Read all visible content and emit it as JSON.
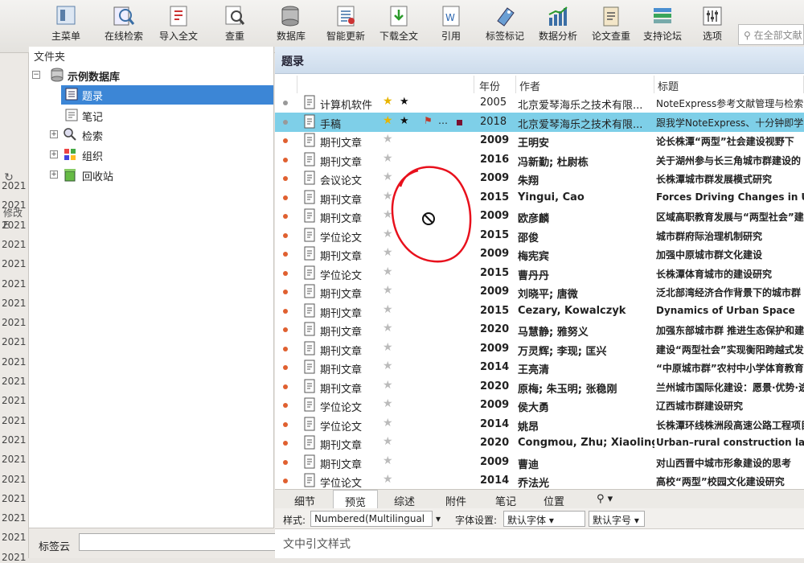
{
  "toolbar": {
    "buttons": [
      {
        "label": "主菜单",
        "icon": "main-menu-icon"
      },
      {
        "label": "在线检索",
        "icon": "online-search-icon"
      },
      {
        "label": "导入全文",
        "icon": "import-fulltext-icon"
      },
      {
        "label": "查重",
        "icon": "duplicate-check-icon"
      },
      {
        "label": "数据库",
        "icon": "database-icon"
      },
      {
        "label": "智能更新",
        "icon": "smart-update-icon"
      },
      {
        "label": "下载全文",
        "icon": "download-fulltext-icon"
      },
      {
        "label": "引用",
        "icon": "cite-icon"
      },
      {
        "label": "标签标记",
        "icon": "tag-icon"
      },
      {
        "label": "数据分析",
        "icon": "data-analysis-icon"
      },
      {
        "label": "论文查重",
        "icon": "paper-check-icon"
      },
      {
        "label": "支持论坛",
        "icon": "forum-icon"
      },
      {
        "label": "选项",
        "icon": "options-icon"
      }
    ],
    "search_placeholder": "在全部文献"
  },
  "left_strip": {
    "modify_label": "修改E",
    "years": [
      "2021",
      "2021",
      "2021",
      "2021",
      "2021",
      "2021",
      "2021",
      "2021",
      "2021",
      "2021",
      "2021",
      "2021",
      "2021",
      "2021",
      "2021",
      "2021",
      "2021",
      "2021",
      "2021",
      "2021"
    ]
  },
  "folder_pane": {
    "header": "文件夹",
    "tree": [
      {
        "label": "示例数据库",
        "icon": "database-icon"
      },
      {
        "label": "题录",
        "icon": "references-icon"
      },
      {
        "label": "笔记",
        "icon": "notes-icon"
      },
      {
        "label": "检索",
        "icon": "search-icon"
      },
      {
        "label": "组织",
        "icon": "organize-icon"
      },
      {
        "label": "回收站",
        "icon": "recycle-bin-icon"
      }
    ],
    "tagcloud_label": "标签云"
  },
  "main": {
    "title": "题录",
    "columns": {
      "year": "年份",
      "author": "作者",
      "title": "标题"
    },
    "rows": [
      {
        "type": "计算机软件",
        "year": "2005",
        "author": "北京爱琴海乐之技术有限...",
        "title": "NoteExpress参考文献管理与检索",
        "starred": true,
        "status": "grey"
      },
      {
        "type": "手稿",
        "year": "2018",
        "author": "北京爱琴海乐之技术有限...",
        "title": "跟我学NoteExpress、十分钟即学",
        "starred": true,
        "status": "grey",
        "selected": true
      },
      {
        "type": "期刊文章",
        "year": "2009",
        "author": "王明安",
        "title": "论长株潭“两型”社会建设视野下",
        "starred": false,
        "status": "red"
      },
      {
        "type": "期刊文章",
        "year": "2016",
        "author": "冯新勤; 杜尉栋",
        "title": "关于湖州参与长三角城市群建设的",
        "starred": false,
        "status": "red"
      },
      {
        "type": "会议论文",
        "year": "2009",
        "author": "朱翔",
        "title": "长株潭城市群发展模式研究",
        "starred": false,
        "status": "red"
      },
      {
        "type": "期刊文章",
        "year": "2015",
        "author": "Yingui, Cao",
        "title": "Forces Driving Changes in Urb",
        "starred": false,
        "status": "red"
      },
      {
        "type": "期刊文章",
        "year": "2009",
        "author": "欧彦麟",
        "title": "区域高职教育发展与“两型社会”建",
        "starred": false,
        "status": "red"
      },
      {
        "type": "学位论文",
        "year": "2015",
        "author": "邵俊",
        "title": "城市群府际治理机制研究",
        "starred": false,
        "status": "red"
      },
      {
        "type": "期刊文章",
        "year": "2009",
        "author": "梅宪宾",
        "title": "加强中原城市群文化建设",
        "starred": false,
        "status": "red"
      },
      {
        "type": "学位论文",
        "year": "2015",
        "author": "曹丹丹",
        "title": "长株潭体育城市的建设研究",
        "starred": false,
        "status": "red"
      },
      {
        "type": "期刊文章",
        "year": "2009",
        "author": "刘晓平; 唐微",
        "title": "泛北部湾经济合作背景下的城市群",
        "starred": false,
        "status": "red"
      },
      {
        "type": "期刊文章",
        "year": "2015",
        "author": "Cezary, Kowalczyk",
        "title": "Dynamics of Urban Space",
        "starred": false,
        "status": "red"
      },
      {
        "type": "期刊文章",
        "year": "2020",
        "author": "马慧静; 雅努义",
        "title": "加强东部城市群 推进生态保护和建设",
        "starred": false,
        "status": "red"
      },
      {
        "type": "期刊文章",
        "year": "2009",
        "author": "万灵辉; 李现; 匡兴",
        "title": "建设“两型社会”实现衡阳跨越式发",
        "starred": false,
        "status": "red"
      },
      {
        "type": "期刊文章",
        "year": "2014",
        "author": "王亮清",
        "title": "“中原城市群”农村中小学体育教育",
        "starred": false,
        "status": "red"
      },
      {
        "type": "期刊文章",
        "year": "2020",
        "author": "原梅; 朱玉明; 张稳刚",
        "title": "兰州城市国际化建设：愿景·优势·途径",
        "starred": false,
        "status": "red"
      },
      {
        "type": "学位论文",
        "year": "2009",
        "author": "侯大勇",
        "title": "辽西城市群建设研究",
        "starred": false,
        "status": "red"
      },
      {
        "type": "学位论文",
        "year": "2014",
        "author": "姚昂",
        "title": "长株潭环线株洲段高速公路工程项目建",
        "starred": false,
        "status": "red"
      },
      {
        "type": "期刊文章",
        "year": "2020",
        "author": "Congmou, Zhu; Xiaoling,",
        "title": "Urban–rural construction land tra",
        "starred": false,
        "status": "red"
      },
      {
        "type": "期刊文章",
        "year": "2009",
        "author": "曹迪",
        "title": "对山西晋中城市形象建设的思考",
        "starred": false,
        "status": "red"
      },
      {
        "type": "学位论文",
        "year": "2014",
        "author": "乔法光",
        "title": "高校“两型”校园文化建设研究",
        "starred": false,
        "status": "red"
      }
    ]
  },
  "bottom": {
    "tabs": [
      "细节",
      "预览",
      "综述",
      "附件",
      "笔记",
      "位置"
    ],
    "active_tab": "预览",
    "style_label": "样式:",
    "style_value": "Numbered(Multilingual",
    "font_label": "字体设置:",
    "font_value": "默认字体",
    "size_value": "默认字号",
    "cite_label": "文中引文样式"
  },
  "colors": {
    "selection": "#3c86d6",
    "row_selection": "#7ecfe8",
    "annotation": "#e8101c"
  }
}
